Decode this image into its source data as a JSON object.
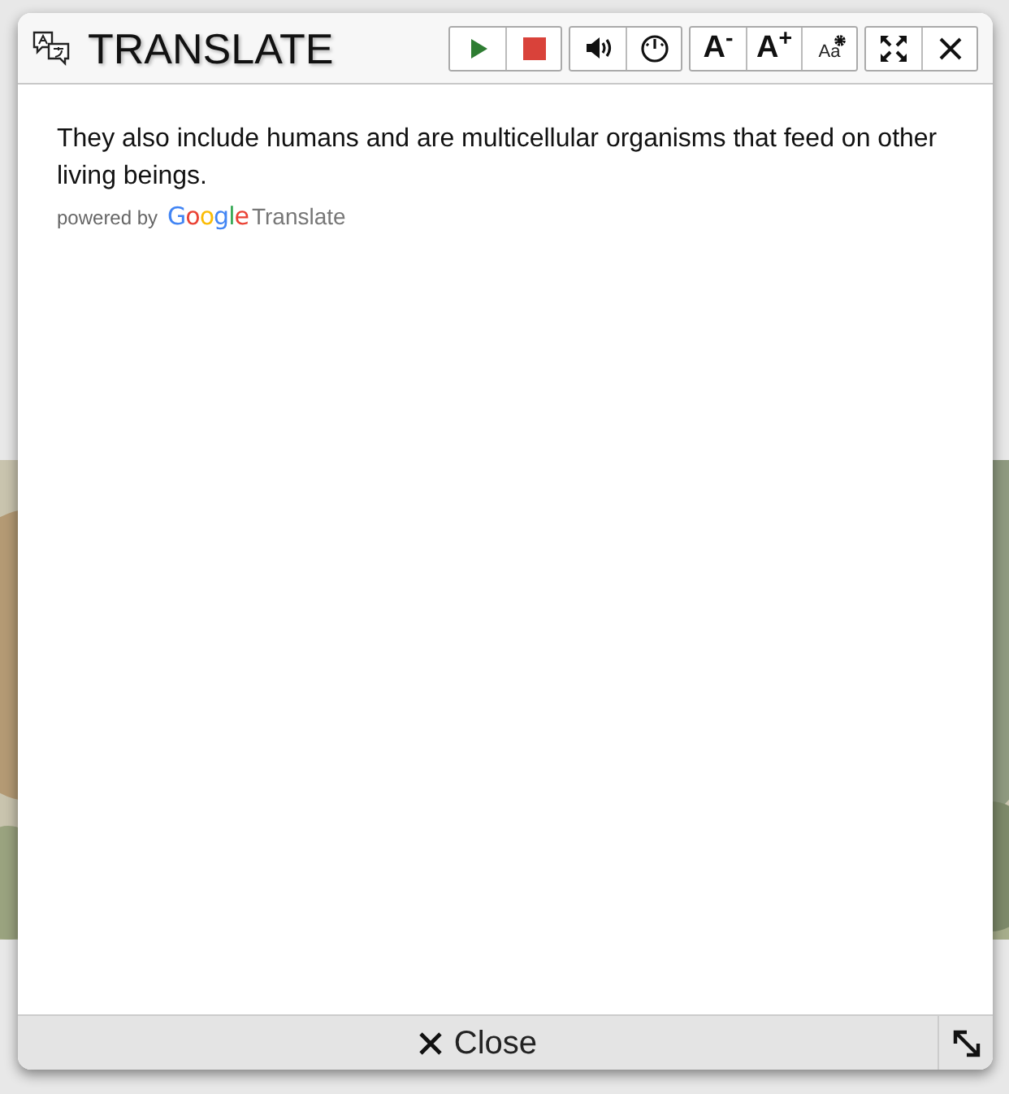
{
  "dialog": {
    "title": "TRANSLATE",
    "toolbar": [
      {
        "buttons": [
          {
            "kind": "play"
          },
          {
            "kind": "stop"
          }
        ]
      },
      {
        "buttons": [
          {
            "kind": "volume"
          },
          {
            "kind": "speed"
          }
        ]
      },
      {
        "buttons": [
          {
            "kind": "text",
            "label": "A$^{-}$"
          },
          {
            "kind": "text",
            "label": "A$^{+}$"
          },
          {
            "kind": "font-settings",
            "label": "Aa"
          }
        ]
      },
      {
        "buttons": [
          {
            "kind": "fullscreen"
          },
          {
            "kind": "close"
          }
        ]
      }
    ],
    "translation": "They also include humans and are multicellular organisms that feed on other living beings.",
    "attribution": {
      "prefix": "powered by",
      "brand": "Google",
      "product": "Translate"
    },
    "footer": {
      "close_label": "Close"
    }
  }
}
